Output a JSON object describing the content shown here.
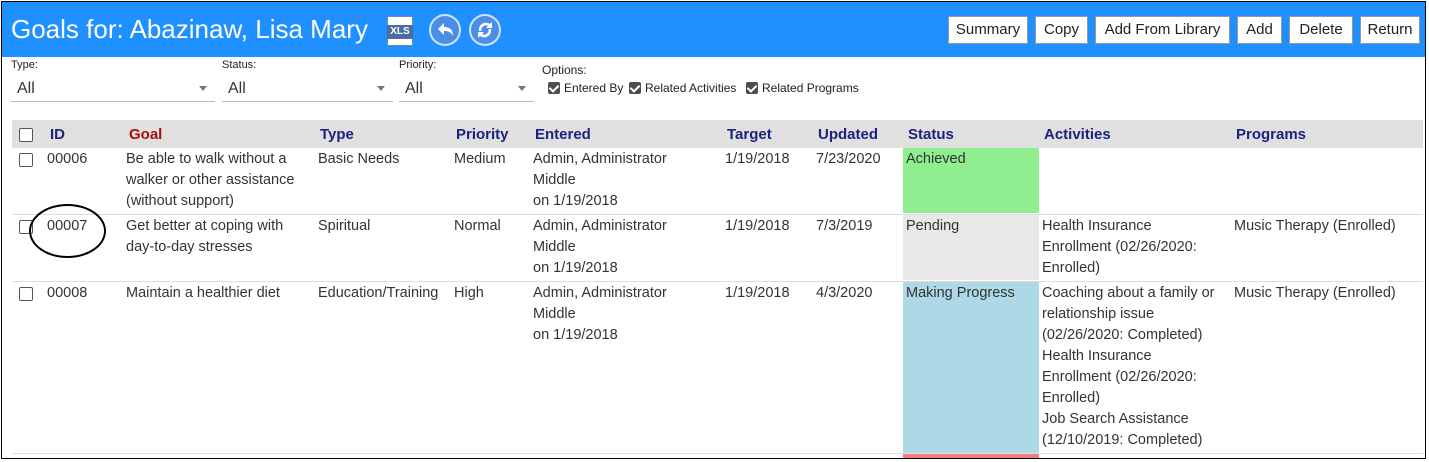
{
  "header": {
    "title": "Goals for: Abazinaw, Lisa Mary",
    "xls_icon_text": "XLS",
    "buttons": [
      "Summary",
      "Copy",
      "Add From Library",
      "Add",
      "Delete",
      "Return"
    ]
  },
  "filters": {
    "type": {
      "label": "Type:",
      "value": "All"
    },
    "status": {
      "label": "Status:",
      "value": "All"
    },
    "priority": {
      "label": "Priority:",
      "value": "All"
    },
    "options_label": "Options:",
    "options": [
      {
        "label": "Entered By",
        "checked": true
      },
      {
        "label": "Related Activities",
        "checked": true
      },
      {
        "label": "Related Programs",
        "checked": true
      }
    ]
  },
  "table": {
    "columns": [
      "ID",
      "Goal",
      "Type",
      "Priority",
      "Entered",
      "Target",
      "Updated",
      "Status",
      "Activities",
      "Programs"
    ],
    "rows": [
      {
        "id": "00006",
        "goal": [
          "Be able to walk without a",
          "walker or other assistance",
          "(without support)"
        ],
        "type": "Basic Needs",
        "priority": "Medium",
        "entered": [
          "Admin, Administrator",
          "Middle",
          "on 1/19/2018"
        ],
        "target": "1/19/2018",
        "updated": "7/23/2020",
        "status": "Achieved",
        "status_color": "#90ee90",
        "activities": [],
        "programs": ""
      },
      {
        "id": "00007",
        "goal": [
          "Get better at coping with",
          "day-to-day stresses"
        ],
        "type": "Spiritual",
        "priority": "Normal",
        "entered": [
          "Admin, Administrator",
          "Middle",
          "on 1/19/2018"
        ],
        "target": "1/19/2018",
        "updated": "7/3/2019",
        "status": "Pending",
        "status_color": "#e8e8e8",
        "activities": [
          "Health Insurance",
          "Enrollment (02/26/2020:",
          "Enrolled)"
        ],
        "programs": "Music Therapy (Enrolled)"
      },
      {
        "id": "00008",
        "goal": [
          "Maintain a healthier diet"
        ],
        "type": "Education/Training",
        "priority": "High",
        "entered": [
          "Admin, Administrator",
          "Middle",
          "on 1/19/2018"
        ],
        "target": "1/19/2018",
        "updated": "4/3/2020",
        "status": "Making Progress",
        "status_color": "#add8e6",
        "activities": [
          "Coaching about a family or",
          "relationship issue",
          "(02/26/2020: Completed)",
          "Health Insurance",
          "Enrollment (02/26/2020:",
          "Enrolled)",
          "Job Search Assistance",
          "(12/10/2019: Completed)"
        ],
        "programs": "Music Therapy (Enrolled)"
      }
    ],
    "partial_row_status_color": "#f08080"
  }
}
